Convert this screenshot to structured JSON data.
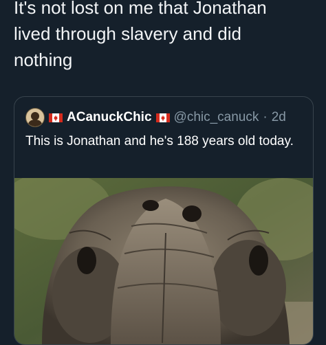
{
  "tweet": {
    "text": "It's not lost on me that Jonathan\nlived through slavery and did\nnothing"
  },
  "quoted_tweet": {
    "display_name": "ACanuckChic",
    "handle": "@chic_canuck",
    "separator": "·",
    "time": "2d",
    "text": "This is Jonathan and he's 188 years old today.",
    "icons": [
      "avatar",
      "canada-flag-icon",
      "canada-flag-icon"
    ],
    "image": "tortoise-face-photo"
  },
  "colors": {
    "background": "#15202b",
    "text": "#ffffff",
    "secondary_text": "#8899a6",
    "border": "#38444d"
  }
}
